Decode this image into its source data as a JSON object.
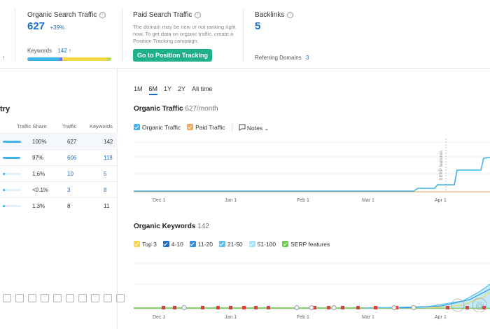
{
  "metrics": {
    "organic": {
      "title": "Organic Search Traffic",
      "value": "627",
      "delta": "+39%",
      "keywords_label": "Keywords",
      "keywords_value": "142 ↑"
    },
    "paid": {
      "title": "Paid Search Traffic",
      "note": "The domain may be new or not ranking right now. To get data on organic traffic, create a Position Tracking campaign.",
      "button": "Go to Position Tracking"
    },
    "backlinks": {
      "title": "Backlinks",
      "value": "5",
      "ref_label": "Referring Domains",
      "ref_value": "3"
    },
    "left_arrow": "↑"
  },
  "keyword_bar_colors": [
    "#3fb4ea",
    "#8e6be0",
    "#f5d54a",
    "#ffce6b"
  ],
  "left_panel": {
    "title": "try",
    "columns": [
      "Traffic Share",
      "Traffic",
      "Keywords"
    ],
    "rows": [
      {
        "share": "100%",
        "traffic": "627",
        "keywords": "142",
        "bar": 1.0,
        "highlight": true
      },
      {
        "share": "97%",
        "traffic": "606",
        "keywords": "118",
        "bar": 0.97,
        "highlight": false
      },
      {
        "share": "1.6%",
        "traffic": "10",
        "keywords": "5",
        "bar": 0.02,
        "highlight": false
      },
      {
        "share": "<0.1%",
        "traffic": "3",
        "keywords": "8",
        "bar": 0.01,
        "highlight": false
      },
      {
        "share": "1.3%",
        "traffic": "8",
        "keywords": "11",
        "bar": 0.02,
        "highlight": false
      }
    ]
  },
  "period_tabs": [
    "1M",
    "6M",
    "1Y",
    "2Y",
    "All time"
  ],
  "traffic_chart": {
    "title": "Organic Traffic",
    "subtitle": "627/month",
    "legend": [
      {
        "label": "Organic Traffic",
        "color": "#3fb4ea"
      },
      {
        "label": "Paid Traffic",
        "color": "#f2a65a"
      }
    ],
    "notes_label": "Notes",
    "annotation": "SERP features",
    "x_labels": [
      "Dec 1",
      "Jan 1",
      "Feb 1",
      "Mar 1",
      "Apr 1"
    ]
  },
  "keywords_chart": {
    "title": "Organic Keywords",
    "subtitle": "142",
    "legend": [
      {
        "label": "Top 3",
        "color": "#f5d54a"
      },
      {
        "label": "4-10",
        "color": "#1a6ec7"
      },
      {
        "label": "11-20",
        "color": "#2f8de4"
      },
      {
        "label": "21-50",
        "color": "#57c3ef"
      },
      {
        "label": "51-100",
        "color": "#a7e2f6"
      },
      {
        "label": "SERP features",
        "color": "#6ac94a"
      }
    ],
    "x_labels": [
      "Dec 1",
      "Jan 1",
      "Feb 1",
      "Mar 1",
      "Apr 1"
    ]
  },
  "colors": {
    "accent": "#1a6ec7",
    "cta": "#20b08a",
    "organic": "#3fb4ea",
    "paid": "#f2a65a",
    "serp": "#6ac94a",
    "marker_red": "#e53b3b"
  }
}
